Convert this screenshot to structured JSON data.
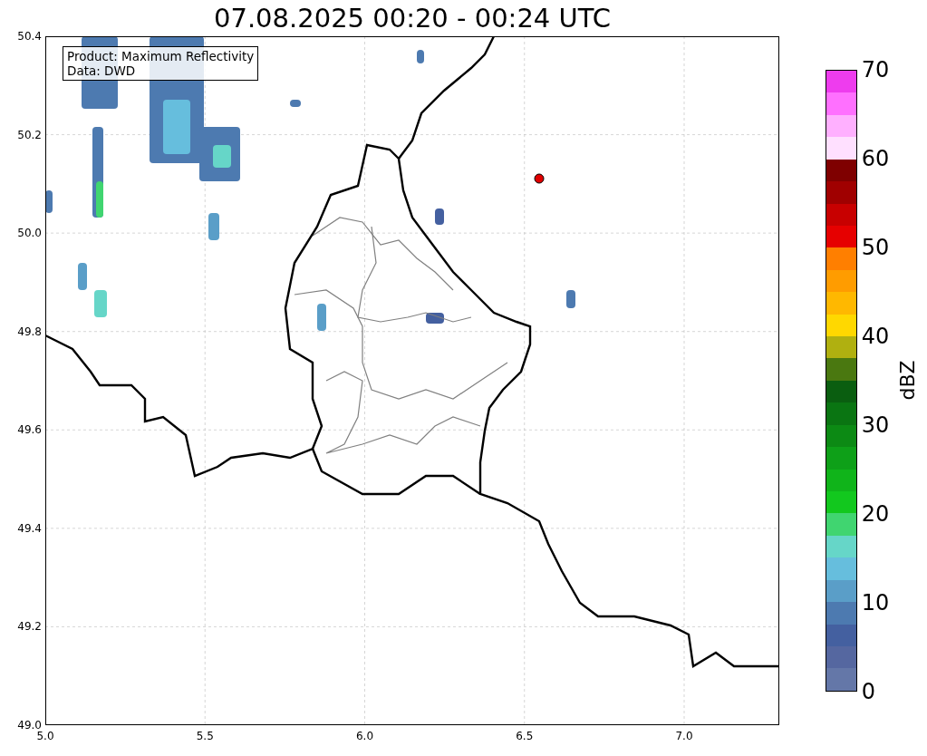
{
  "title": "07.08.2025 00:20 - 00:24 UTC",
  "map": {
    "legend": [
      "Product: Maximum Reflectivity",
      "Data: DWD"
    ],
    "x_ticks": [
      "5.0",
      "5.5",
      "6.0",
      "6.5",
      "7.0"
    ],
    "y_ticks": [
      "50.4",
      "50.2",
      "50.0",
      "49.8",
      "49.6",
      "49.4",
      "49.2",
      "49.0"
    ]
  },
  "colorbar": {
    "label": "dBZ",
    "ticks": [
      "70",
      "60",
      "50",
      "40",
      "30",
      "20",
      "10",
      "0"
    ],
    "segments": [
      {
        "color": "#ee3cee"
      },
      {
        "color": "#ff70ff"
      },
      {
        "color": "#ffb0ff"
      },
      {
        "color": "#ffe0ff"
      },
      {
        "color": "#7f0000"
      },
      {
        "color": "#a00000"
      },
      {
        "color": "#c80000"
      },
      {
        "color": "#e60000"
      },
      {
        "color": "#ff7f00"
      },
      {
        "color": "#ff9c00"
      },
      {
        "color": "#ffb800"
      },
      {
        "color": "#ffd800"
      },
      {
        "color": "#b0b010"
      },
      {
        "color": "#4a7810"
      },
      {
        "color": "#0a5e10"
      },
      {
        "color": "#0a7512"
      },
      {
        "color": "#0c8a14"
      },
      {
        "color": "#0ea018"
      },
      {
        "color": "#10b41a"
      },
      {
        "color": "#12c81e"
      },
      {
        "color": "#40d570"
      },
      {
        "color": "#66d6c8"
      },
      {
        "color": "#66bedd"
      },
      {
        "color": "#5a9ec8"
      },
      {
        "color": "#4d7ab0"
      },
      {
        "color": "#4460a0"
      },
      {
        "color": "#5567a0"
      },
      {
        "color": "#6477a8"
      }
    ]
  }
}
